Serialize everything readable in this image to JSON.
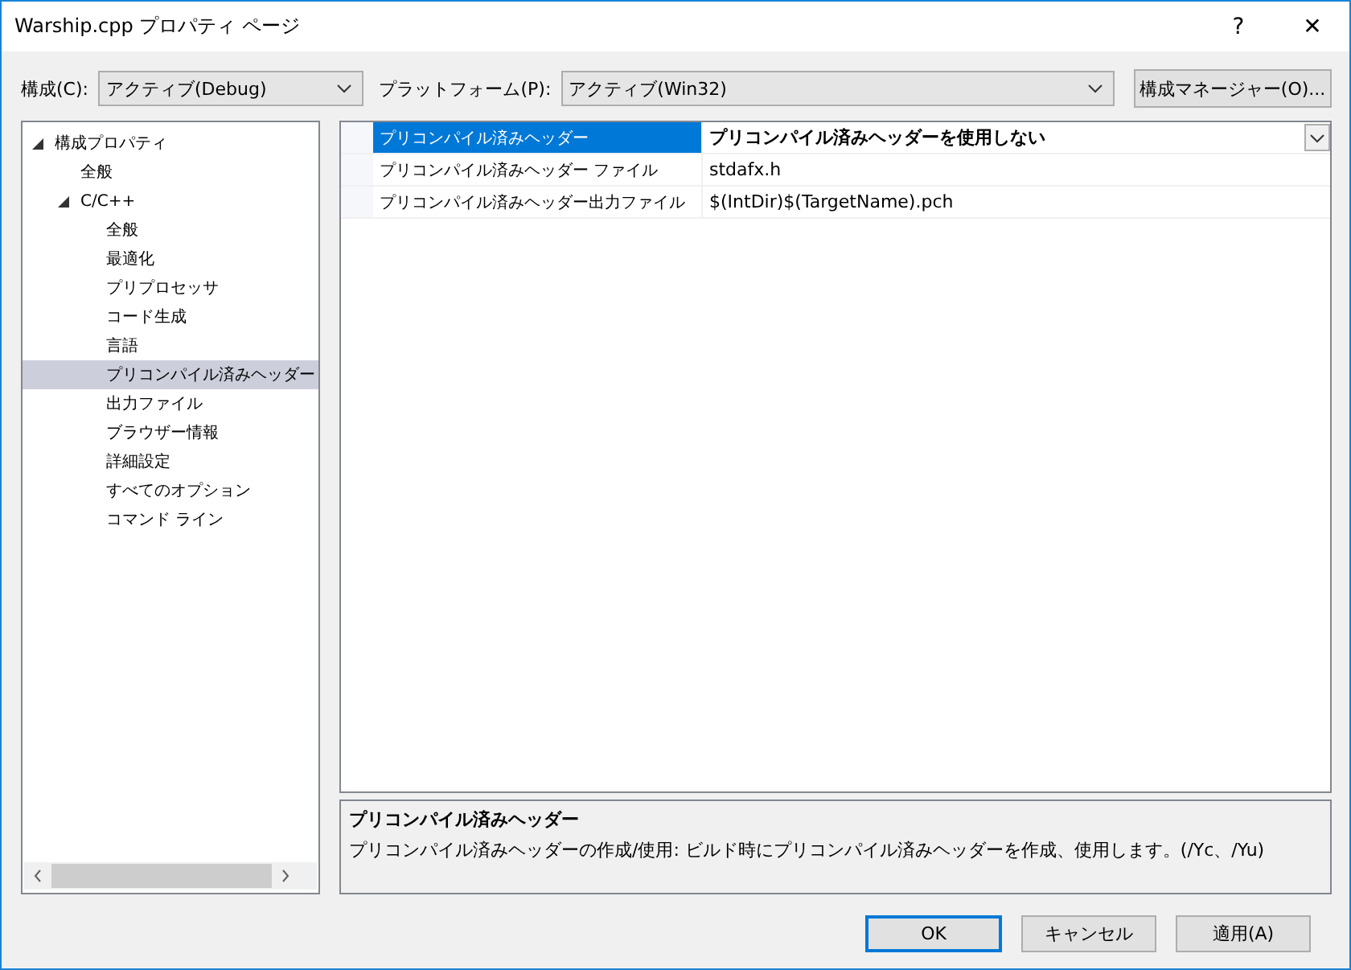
{
  "window": {
    "title": "Warship.cpp プロパティ ページ",
    "help": "?",
    "close": "✕"
  },
  "toolbar": {
    "config_label": "構成(C):",
    "config_value": "アクティブ(Debug)",
    "platform_label": "プラットフォーム(P):",
    "platform_value": "アクティブ(Win32)",
    "manager_button": "構成マネージャー(O)..."
  },
  "tree": [
    {
      "label": "構成プロパティ",
      "expanded": true,
      "selected": false,
      "children": [
        {
          "label": "全般",
          "selected": false
        },
        {
          "label": "C/C++",
          "expanded": true,
          "selected": false,
          "children": [
            {
              "label": "全般",
              "selected": false
            },
            {
              "label": "最適化",
              "selected": false
            },
            {
              "label": "プリプロセッサ",
              "selected": false
            },
            {
              "label": "コード生成",
              "selected": false
            },
            {
              "label": "言語",
              "selected": false
            },
            {
              "label": "プリコンパイル済みヘッダー",
              "selected": true
            },
            {
              "label": "出力ファイル",
              "selected": false
            },
            {
              "label": "ブラウザー情報",
              "selected": false
            },
            {
              "label": "詳細設定",
              "selected": false
            },
            {
              "label": "すべてのオプション",
              "selected": false
            },
            {
              "label": "コマンド ライン",
              "selected": false
            }
          ]
        }
      ]
    }
  ],
  "grid": [
    {
      "name": "プリコンパイル済みヘッダー",
      "value": "プリコンパイル済みヘッダーを使用しない",
      "selected": true,
      "bold": true
    },
    {
      "name": "プリコンパイル済みヘッダー ファイル",
      "value": "stdafx.h",
      "selected": false,
      "bold": false
    },
    {
      "name": "プリコンパイル済みヘッダー出力ファイル",
      "value": "$(IntDir)$(TargetName).pch",
      "selected": false,
      "bold": false
    }
  ],
  "description": {
    "title": "プリコンパイル済みヘッダー",
    "text": "プリコンパイル済みヘッダーの作成/使用: ビルド時にプリコンパイル済みヘッダーを作成、使用します。(/Yc、/Yu)"
  },
  "buttons": [
    {
      "label": "OK",
      "default": true
    },
    {
      "label": "キャンセル",
      "default": false
    },
    {
      "label": "適用(A)",
      "default": false
    }
  ]
}
